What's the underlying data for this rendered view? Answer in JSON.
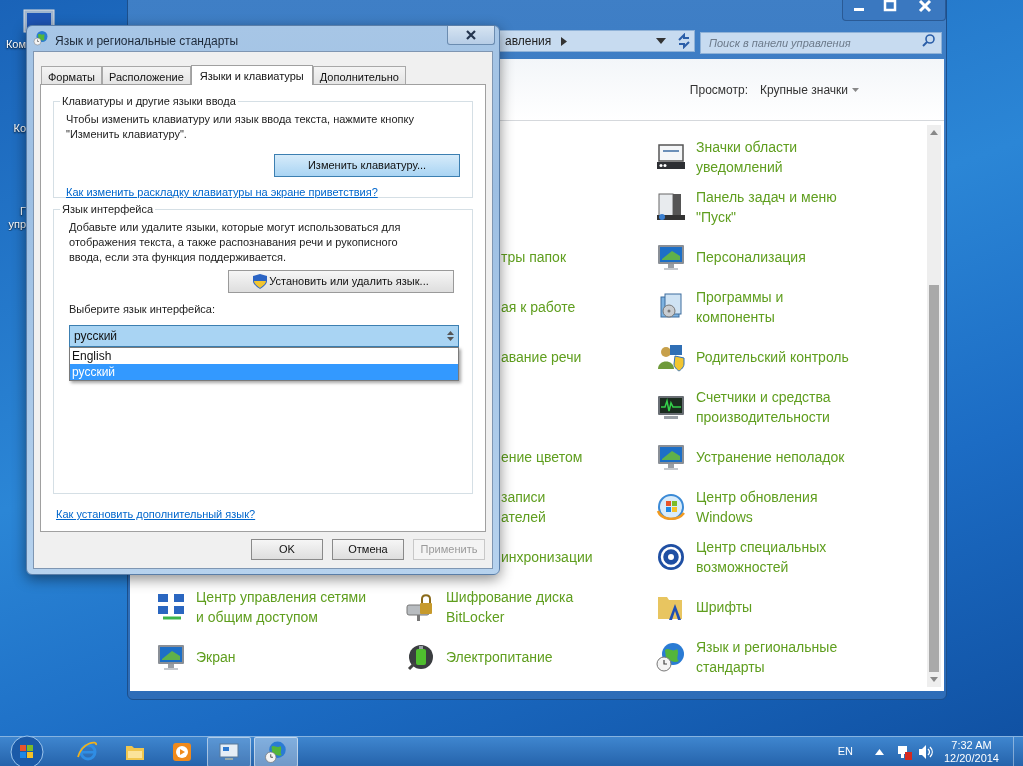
{
  "desktop_icons": [
    {
      "lines": [
        "Ком"
      ]
    },
    {
      "lines": [
        "Ко"
      ]
    },
    {
      "lines": [
        "Г",
        "упр"
      ]
    }
  ],
  "control_panel": {
    "address_fragment": "авления",
    "search": {
      "placeholder": "Поиск в панели управления"
    },
    "view_label": "Просмотр:",
    "view_mode": "Крупные значки",
    "rows": [
      {
        "right": {
          "kind": "full",
          "lines": [
            "Значки области",
            "уведомлений"
          ]
        }
      },
      {
        "right": {
          "kind": "full",
          "lines": [
            "Панель задач и меню",
            "\"Пуск\""
          ]
        }
      },
      {
        "middle": {
          "kind": "partial",
          "lines": [
            "тры папок"
          ]
        },
        "right": {
          "kind": "full",
          "lines": [
            "Персонализация"
          ]
        }
      },
      {
        "middle": {
          "kind": "partial",
          "lines": [
            "ая к работе"
          ]
        },
        "right": {
          "kind": "full",
          "lines": [
            "Программы и",
            "компоненты"
          ]
        }
      },
      {
        "middle": {
          "kind": "partial",
          "lines": [
            "авание речи"
          ]
        },
        "right": {
          "kind": "full",
          "lines": [
            "Родительский контроль"
          ]
        }
      },
      {
        "right": {
          "kind": "full",
          "lines": [
            "Счетчики и средства",
            "производительности"
          ]
        }
      },
      {
        "middle": {
          "kind": "partial",
          "lines": [
            "ение цветом"
          ]
        },
        "right": {
          "kind": "full",
          "lines": [
            "Устранение неполадок"
          ]
        }
      },
      {
        "middle": {
          "kind": "partial",
          "lines": [
            "записи",
            "ателей"
          ]
        },
        "right": {
          "kind": "full",
          "lines": [
            "Центр обновления",
            "Windows"
          ]
        }
      },
      {
        "middle": {
          "kind": "partial",
          "lines": [
            "инхронизации"
          ]
        },
        "right": {
          "kind": "full",
          "lines": [
            "Центр специальных",
            "возможностей"
          ]
        }
      },
      {
        "left": {
          "kind": "full",
          "lines": [
            "Центр управления сетями",
            "и общим доступом"
          ]
        },
        "middle": {
          "kind": "full",
          "lines": [
            "Шифрование диска",
            "BitLocker"
          ]
        },
        "right": {
          "kind": "full",
          "lines": [
            "Шрифты"
          ]
        }
      },
      {
        "left": {
          "kind": "full",
          "lines": [
            "Экран"
          ]
        },
        "middle": {
          "kind": "full",
          "lines": [
            "Электропитание"
          ]
        },
        "right": {
          "kind": "full",
          "lines": [
            "Язык и региональные",
            "стандарты"
          ]
        }
      }
    ]
  },
  "dialog": {
    "title": "Язык и региональные стандарты",
    "tabs": [
      {
        "label": "Форматы",
        "selected": false
      },
      {
        "label": "Расположение",
        "selected": false
      },
      {
        "label": "Языки и клавиатуры",
        "selected": true
      },
      {
        "label": "Дополнительно",
        "selected": false
      }
    ],
    "keyboards_group": {
      "title": "Клавиатуры и другие языки ввода",
      "lines": [
        "Чтобы изменить клавиатуру или язык ввода текста, нажмите кнопку",
        "\"Изменить клавиатуру\"."
      ],
      "button": "Изменить клавиатуру...",
      "link": "Как изменить раскладку клавиатуры на экране приветствия?"
    },
    "interface_group": {
      "title": "Язык интерфейса",
      "lines": [
        "Добавьте или удалите языки, которые могут использоваться для",
        "отображения текста, а также распознавания речи и рукописного",
        "ввода, если эта функция поддерживается."
      ],
      "button": "Установить или удалить язык...",
      "select_label": "Выберите язык интерфейса:",
      "select_value": "русский",
      "options": [
        {
          "label": "English",
          "selected": false
        },
        {
          "label": "русский",
          "selected": true
        }
      ]
    },
    "link": "Как установить дополнительный язык?",
    "buttons": [
      {
        "label": "OK",
        "disabled": false
      },
      {
        "label": "Отмена",
        "disabled": false
      },
      {
        "label": "Применить",
        "disabled": true
      }
    ]
  },
  "taskbar": {
    "buttons": [
      {
        "open": false,
        "selected": false
      },
      {
        "open": false,
        "selected": false
      },
      {
        "open": false,
        "selected": false
      },
      {
        "open": true,
        "selected": false
      },
      {
        "open": true,
        "selected": true
      }
    ],
    "language": "EN",
    "time": "7:32 AM",
    "date": "12/20/2014"
  }
}
